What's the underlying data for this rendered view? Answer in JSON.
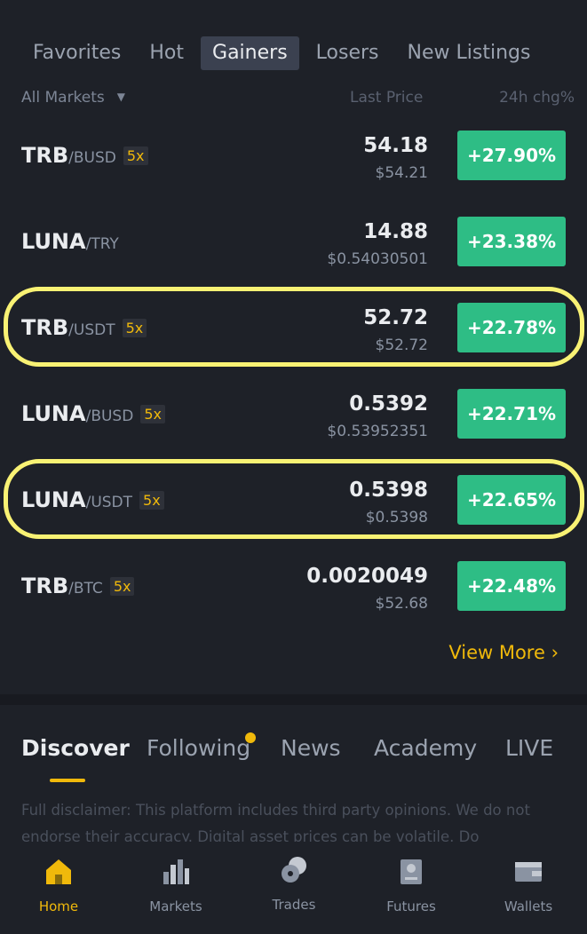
{
  "tabs": [
    "Favorites",
    "Hot",
    "Gainers",
    "Losers",
    "New Listings"
  ],
  "active_tab": "Gainers",
  "subheader": {
    "markets": "All Markets",
    "last_price": "Last Price",
    "change": "24h chg%"
  },
  "rows": [
    {
      "base": "TRB",
      "quote": "/BUSD",
      "leverage": "5x",
      "price": "54.18",
      "usd": "$54.21",
      "change": "+27.90%"
    },
    {
      "base": "LUNA",
      "quote": "/TRY",
      "leverage": "",
      "price": "14.88",
      "usd": "$0.54030501",
      "change": "+23.38%"
    },
    {
      "base": "TRB",
      "quote": "/USDT",
      "leverage": "5x",
      "price": "52.72",
      "usd": "$52.72",
      "change": "+22.78%",
      "highlighted": true
    },
    {
      "base": "LUNA",
      "quote": "/BUSD",
      "leverage": "5x",
      "price": "0.5392",
      "usd": "$0.53952351",
      "change": "+22.71%"
    },
    {
      "base": "LUNA",
      "quote": "/USDT",
      "leverage": "5x",
      "price": "0.5398",
      "usd": "$0.5398",
      "change": "+22.65%",
      "highlighted": true
    },
    {
      "base": "TRB",
      "quote": "/BTC",
      "leverage": "5x",
      "price": "0.0020049",
      "usd": "$52.68",
      "change": "+22.48%"
    }
  ],
  "view_more": "View More",
  "discover_tabs": [
    "Discover",
    "Following",
    "News",
    "Academy",
    "LIVE"
  ],
  "disclaimer": "Full disclaimer: This platform includes third party opinions. We do not endorse their accuracy. Digital asset prices can be volatile. Do",
  "nav": [
    {
      "label": "Home",
      "icon": "home-icon",
      "active": true
    },
    {
      "label": "Markets",
      "icon": "markets-icon"
    },
    {
      "label": "Trades",
      "icon": "trades-icon"
    },
    {
      "label": "Futures",
      "icon": "futures-icon"
    },
    {
      "label": "Wallets",
      "icon": "wallet-icon"
    }
  ],
  "colors": {
    "accent": "#f0b90b",
    "positive": "#2ebd85",
    "highlight": "#f9f274",
    "background": "#1e2128"
  }
}
